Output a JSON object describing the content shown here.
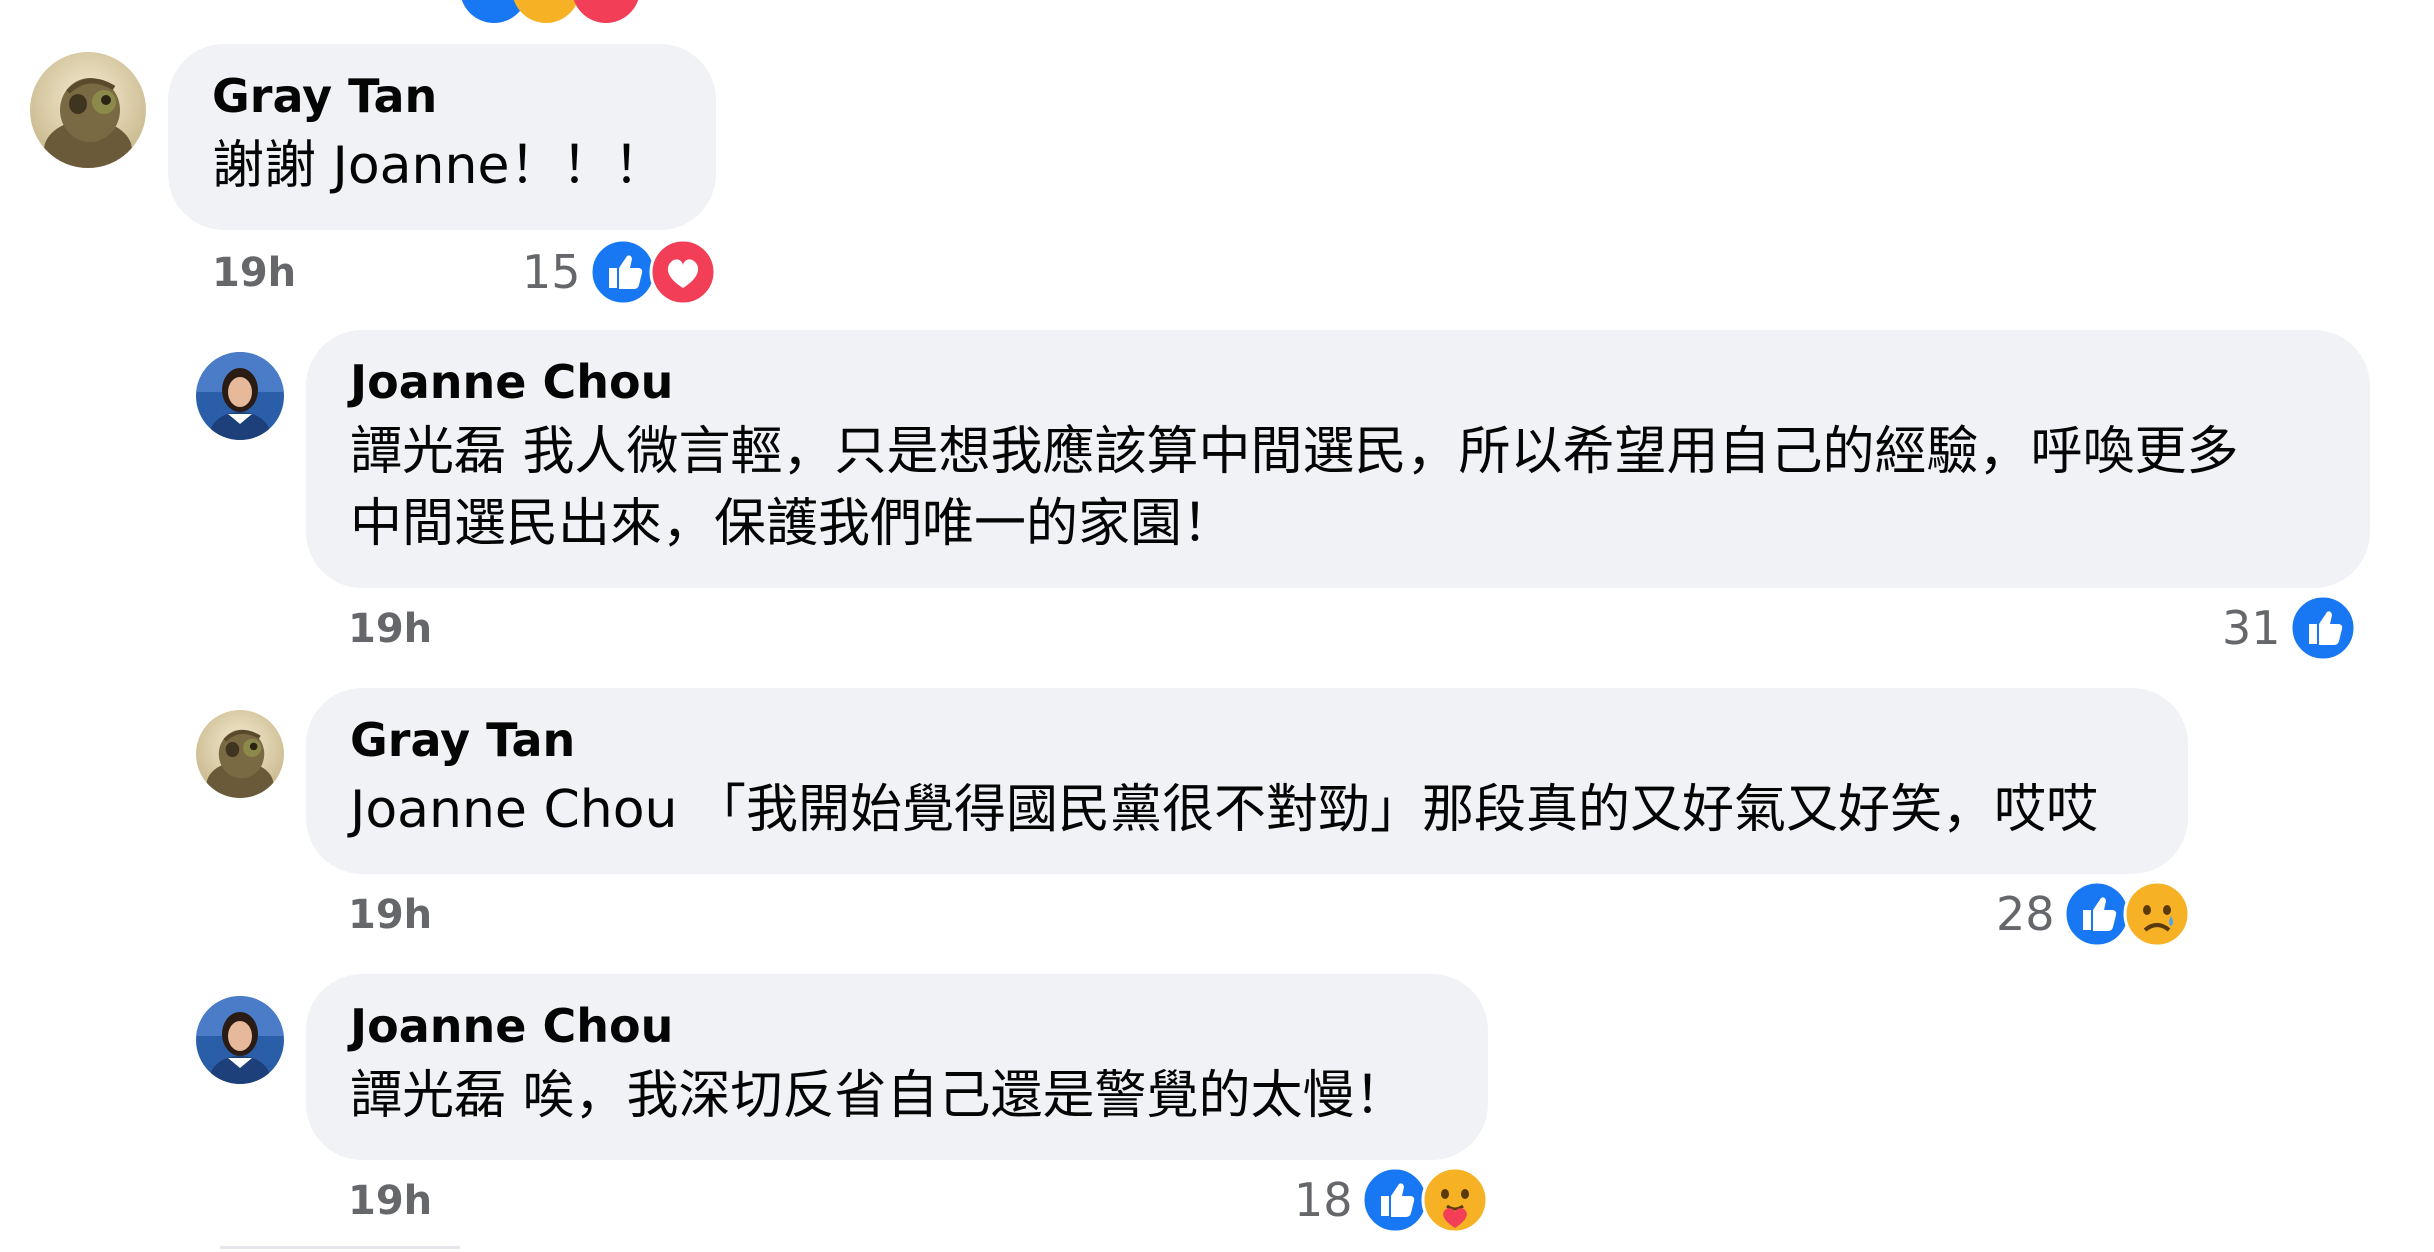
{
  "comments": [
    {
      "author": "Gray Tan",
      "text": "謝謝 Joanne！！！",
      "time": "19h",
      "reaction_count": "15",
      "reactions": [
        "like-icon",
        "love-icon"
      ]
    },
    {
      "author": "Joanne Chou",
      "text_line1": "譚光磊 我人微言輕，只是想我應該算中間選民，所以希望用自己的經驗，呼喚更多",
      "text_line2": "中間選民出來，保護我們唯一的家園！",
      "time": "19h",
      "reaction_count": "31",
      "reactions": [
        "like-icon"
      ]
    },
    {
      "author": "Gray Tan",
      "text": "Joanne Chou 「我開始覺得國民黨很不對勁」那段真的又好氣又好笑，哎哎",
      "time": "19h",
      "reaction_count": "28",
      "reactions": [
        "like-icon",
        "sad-icon"
      ]
    },
    {
      "author": "Joanne Chou",
      "text": "譚光磊 唉，我深切反省自己還是警覺的太慢！",
      "time": "19h",
      "reaction_count": "18",
      "reactions": [
        "like-icon",
        "care-icon"
      ]
    }
  ],
  "colors": {
    "bubble": "#f0f2f5",
    "meta_text": "#65676b",
    "like_blue": "#1877f2",
    "love_red": "#f33e58",
    "emoji_yellow": "#f7b125"
  }
}
